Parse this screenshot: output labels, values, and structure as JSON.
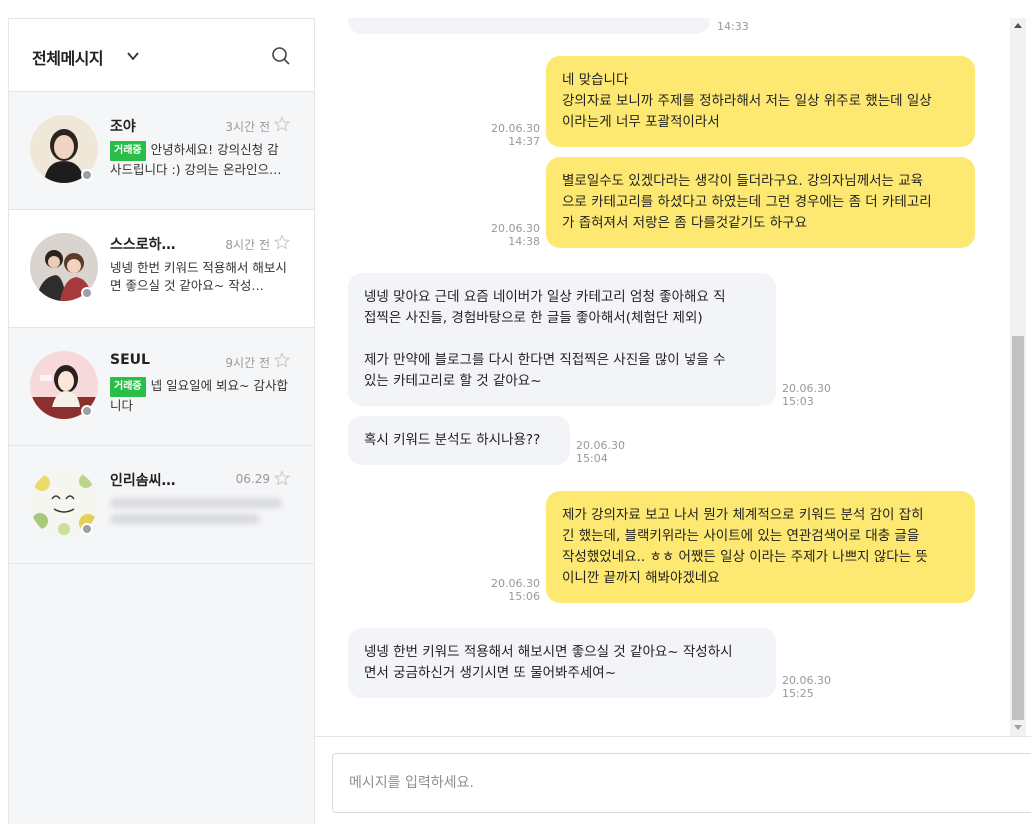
{
  "sidebar": {
    "title": "전체메시지",
    "conversations": [
      {
        "name": "조야",
        "time": "3시간 전",
        "badge": "거래중",
        "preview": "안녕하세요! 강의신청 감사드립니다 :) 강의는 온라인으…"
      },
      {
        "name": "스스로하…",
        "time": "8시간 전",
        "badge": "",
        "preview": "넹넹 한번 키워드 적용해서 해보시면 좋으실 것 같아요~ 작성…"
      },
      {
        "name": "SEUL",
        "time": "9시간 전",
        "badge": "거래중",
        "preview": "넵 일요일에 뵈요~ 감사합니다"
      },
      {
        "name": "인리솜씨…",
        "time": "06.29",
        "badge": "",
        "preview": ""
      }
    ]
  },
  "chat": {
    "top_stamp": "14:33",
    "messages": [
      {
        "dir": "out",
        "lines": [
          "네 맞습니다",
          "강의자료 보니까 주제를 정하라해서 저는 일상 위주로 했는데 일상",
          "이라는게 너무 포괄적이라서"
        ],
        "date": "20.06.30",
        "time": "14:37"
      },
      {
        "dir": "out",
        "lines": [
          "별로일수도 있겠다라는 생각이 들더라구요. 강의자님께서는 교육",
          "으로 카테고리를 하셨다고 하였는데 그런 경우에는 좀 더 카테고리",
          "가 좁혀져서 저랑은 좀 다를것같기도 하구요"
        ],
        "date": "20.06.30",
        "time": "14:38"
      },
      {
        "dir": "in",
        "lines": [
          "넹넹 맞아요 근데 요즘 네이버가 일상 카테고리 엄청 좋아해요 직",
          "접찍은 사진들, 경험바탕으로 한 글들 좋아해서(체험단 제외)",
          "",
          "제가 만약에 블로그를 다시 한다면 직접찍은 사진을 많이 넣을 수",
          "있는 카테고리로 할 것 같아요~"
        ],
        "date": "20.06.30",
        "time": "15:03"
      },
      {
        "dir": "in",
        "lines": [
          "혹시 키워드 분석도 하시나용??"
        ],
        "date": "20.06.30",
        "time": "15:04"
      },
      {
        "dir": "out",
        "lines": [
          "제가 강의자료 보고 나서 뭔가 체계적으로 키워드 분석 감이 잡히",
          "긴 했는데, 블랙키위라는 사이트에 있는 연관검색어로 대충 글을",
          "작성했었네요.. ㅎㅎ 어쨌든 일상 이라는 주제가 나쁘지 않다는 뜻",
          "이니깐 끝까지 해봐야겠네요"
        ],
        "date": "20.06.30",
        "time": "15:06"
      },
      {
        "dir": "in",
        "lines": [
          "넹넹 한번 키워드 적용해서 해보시면 좋으실 것 같아요~ 작성하시",
          "면서 궁금하신거 생기시면 또 물어봐주세여~"
        ],
        "date": "20.06.30",
        "time": "15:25"
      }
    ]
  },
  "composer": {
    "placeholder": "메시지를 입력하세요."
  },
  "colors": {
    "outgoing_bubble": "#fde971",
    "incoming_bubble": "#f3f4f7",
    "badge": "#2bbd4a"
  },
  "icons": [
    "chevron-down-icon",
    "search-icon",
    "star-icon",
    "scroll-up-icon",
    "scroll-down-icon"
  ]
}
